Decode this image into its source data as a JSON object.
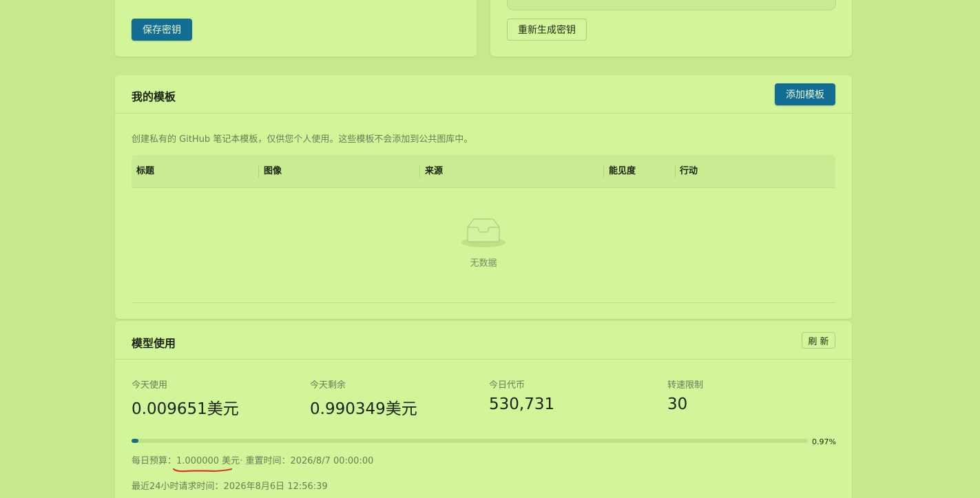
{
  "key_section": {
    "save_button": "保存密钥",
    "regenerate_button": "重新生成密钥"
  },
  "templates": {
    "title": "我的模板",
    "add_button": "添加模板",
    "description": "创建私有的 GitHub 笔记本模板，仅供您个人使用。这些模板不会添加到公共图库中。",
    "columns": [
      "标题",
      "图像",
      "来源",
      "能见度",
      "行动"
    ],
    "empty_text": "无数据"
  },
  "usage": {
    "title": "模型使用",
    "refresh_button": "刷 新",
    "stats": [
      {
        "label": "今天使用",
        "value": "0.009651美元"
      },
      {
        "label": "今天剩余",
        "value": "0.990349美元"
      },
      {
        "label": "今日代币",
        "value": "530,731"
      },
      {
        "label": "转速限制",
        "value": "30"
      }
    ],
    "progress_percent": 0.97,
    "progress_text": "0.97%",
    "budget_label": "每日预算：",
    "budget_value": "1.000000 美元",
    "reset_label": "· 重置时间：",
    "reset_value": "2026/8/7 00:00:00",
    "last_request_label": "最近24小时请求时间：",
    "last_request_value": "2026年8月6日 12:56:39"
  },
  "colors": {
    "background": "#c8e88c",
    "card": "#d1f598",
    "primary": "#136d93",
    "annotation": "#e0362c"
  }
}
